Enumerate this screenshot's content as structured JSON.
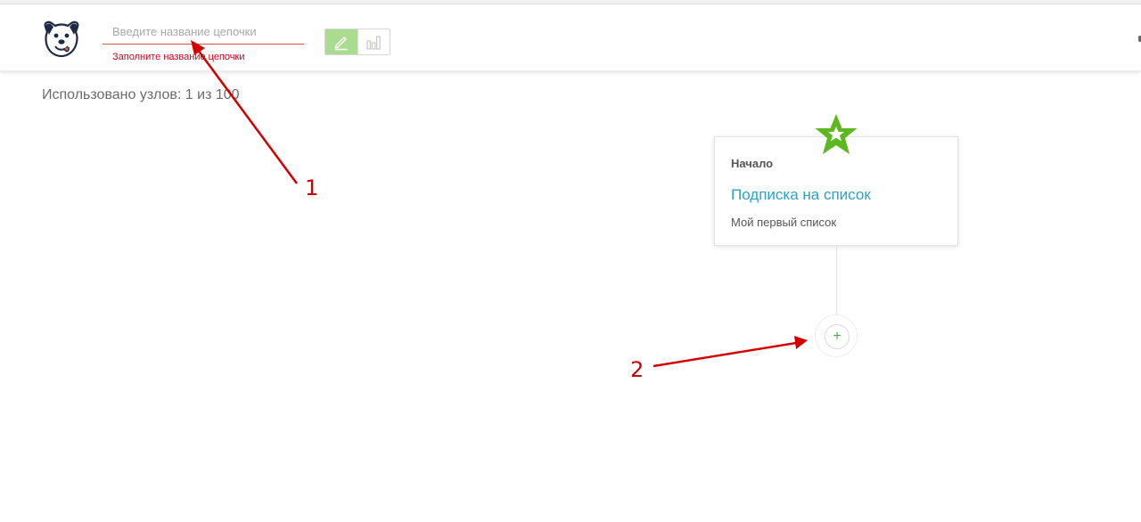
{
  "header": {
    "name_input": {
      "placeholder": "Введите название цепочки",
      "value": ""
    },
    "name_error": "Заполните название цепочки",
    "mode_toggle": {
      "edit_icon": "pencil-icon",
      "stats_icon": "bar-chart-icon",
      "active": "edit"
    }
  },
  "usage_text": "Использовано узлов: 1 из 100",
  "start_node": {
    "label": "Начало",
    "trigger": "Подписка на список",
    "list_name": "Мой первый список",
    "badge_icon": "star-icon",
    "badge_color": "#5cb81e"
  },
  "add_node_button": {
    "label": "+",
    "icon": "plus-icon"
  },
  "annotations": [
    {
      "label": "1"
    },
    {
      "label": "2"
    }
  ],
  "colors": {
    "accent_green": "#a9dc8f",
    "link_blue": "#2aa3c7",
    "error_red": "#d0021b",
    "annotation_red": "#d40000"
  }
}
